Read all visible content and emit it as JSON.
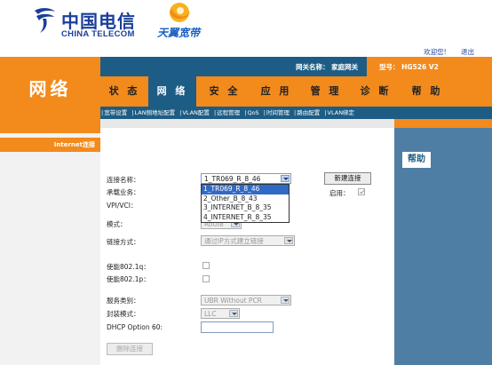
{
  "header": {
    "logo_cn": "中国电信",
    "logo_en": "CHINA TELECOM",
    "brand": "天翼宽带",
    "links": [
      "欢迎您!",
      "退出"
    ]
  },
  "section": {
    "title": "网络"
  },
  "infobar": {
    "gateway_name": "网关名称： 家庭网关",
    "model": "型号： HG526 V2"
  },
  "nav": {
    "tabs": [
      "状 态",
      "网 络",
      "安 全",
      "应 用",
      "管 理",
      "诊 断",
      "帮 助"
    ],
    "active": "网 络"
  },
  "subnav": [
    "宽带设置",
    "LAN侧地址配置",
    "VLAN配置",
    "远程管理",
    "QoS",
    "时间管理",
    "路由配置",
    "VLAN绑定"
  ],
  "left": {
    "item": "Internet连接"
  },
  "help": {
    "title": "帮助"
  },
  "form": {
    "connection_name_label": "连接名称：",
    "connection_name_value": "1_TR069_R_8_46",
    "new_connection_button": "新建连接",
    "enable_label": "启用：",
    "service_label": "承载业务：",
    "vpi_vci_label": "VPI/VCI：",
    "mode_label": "模式：",
    "mode_value": "Route",
    "dial_label": "链接方式：",
    "dial_value": "通过IP方式建立链接",
    "dot1q_label": "使能802.1q：",
    "dot1p_label": "使能802.1p：",
    "service_type_label": "服务类别：",
    "service_type_value": "UBR Without PCR",
    "encap_label": "封装模式：",
    "encap_value": "LLC",
    "dhcp_label": "DHCP Option 60:",
    "delete_button": "删除连接",
    "dropdown_options": [
      "1_TR069_R_8_46",
      "2_Other_B_8_43",
      "3_INTERNET_B_8_35",
      "4_INTERNET_R_8_35"
    ],
    "dropdown_selected": "1_TR069_R_8_46"
  },
  "colors": {
    "orange": "#f28a1c",
    "navy": "#1d5c84",
    "help_blue": "#4f7ea5"
  }
}
